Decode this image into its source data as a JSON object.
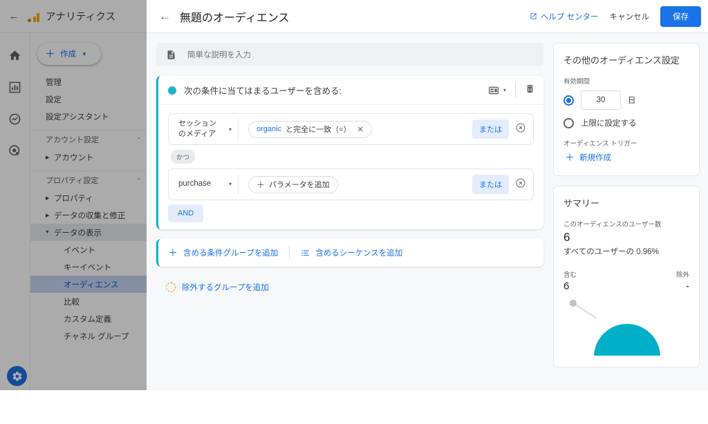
{
  "nav": {
    "back_icon": "arrow-left-icon",
    "brand": "アナリティクス",
    "create_label": "作成",
    "rail_icons": [
      "home-icon",
      "reports-bar-chart-icon",
      "explore-icon",
      "advertising-target-icon"
    ],
    "settings_fab_icon": "gear-icon",
    "items": [
      {
        "label": "管理",
        "type": "item"
      },
      {
        "label": "設定",
        "type": "item"
      },
      {
        "label": "設定アシスタント",
        "type": "item"
      },
      {
        "label": "アカウント設定",
        "type": "section"
      },
      {
        "label": "アカウント",
        "type": "collapsed"
      },
      {
        "label": "プロパティ設定",
        "type": "section"
      },
      {
        "label": "プロパティ",
        "type": "collapsed"
      },
      {
        "label": "データの収集と修正",
        "type": "collapsed"
      },
      {
        "label": "データの表示",
        "type": "expanded"
      },
      {
        "label": "イベント",
        "type": "child"
      },
      {
        "label": "キーイベント",
        "type": "child"
      },
      {
        "label": "オーディエンス",
        "type": "child-active"
      },
      {
        "label": "比較",
        "type": "child"
      },
      {
        "label": "カスタム定義",
        "type": "child"
      },
      {
        "label": "チャネル グループ",
        "type": "child"
      }
    ]
  },
  "header": {
    "back_icon": "arrow-left-icon",
    "title": "無題のオーディエンス",
    "help_icon": "open-in-new-icon",
    "help_label": "ヘルプ センター",
    "cancel_label": "キャンセル",
    "save_label": "保存"
  },
  "description": {
    "icon": "description-document-icon",
    "placeholder": "簡単な説明を入力"
  },
  "include_group": {
    "dot_color": "#1ab5ca",
    "title": "次の条件に当てはまるユーザーを含める:",
    "scope_icon": "scope-card-icon",
    "scope_caret": "▾",
    "delete_icon": "trash-icon",
    "conditions": [
      {
        "dimension": "セッション\nのメディア",
        "dimension_line1": "セッション",
        "dimension_line2": "のメディア",
        "caret": "▾",
        "chip_value": "organic",
        "chip_operator": "と完全に一致（=）",
        "chip_close": "✕",
        "or_label": "または",
        "remove_icon": "remove-circle-icon"
      },
      {
        "dimension_line1": "purchase",
        "dimension_line2": "",
        "caret": "▾",
        "chip_add_plus": "＋",
        "chip_add_label": "パラメータを追加",
        "or_label": "または",
        "remove_icon": "remove-circle-icon"
      }
    ],
    "and_connector_chip": "かつ",
    "and_button": "AND"
  },
  "add_row": {
    "add_condition_group_icon": "plus-icon",
    "add_condition_group": "含める条件グループを追加",
    "add_sequence_icon": "sequence-list-icon",
    "add_sequence": "含めるシーケンスを追加"
  },
  "exclude_row": {
    "icon": "dashed-circle-icon",
    "label": "除外するグループを追加"
  },
  "settings_card": {
    "title": "その他のオーディエンス設定",
    "duration_label": "有効期間",
    "duration_value": "30",
    "duration_unit": "日",
    "duration_selected": true,
    "max_label": "上限に設定する",
    "trigger_label": "オーディエンス トリガー",
    "new_plus": "＋",
    "new_label": "新規作成"
  },
  "summary_card": {
    "title": "サマリー",
    "users_label": "このオーディエンスのユーザー数",
    "users_value": "6",
    "percent_text": "すべてのユーザーの 0.96%",
    "include_label": "含む",
    "include_value": "6",
    "exclude_label": "除外",
    "exclude_value": "-",
    "venn_color": "#00b0c8"
  }
}
